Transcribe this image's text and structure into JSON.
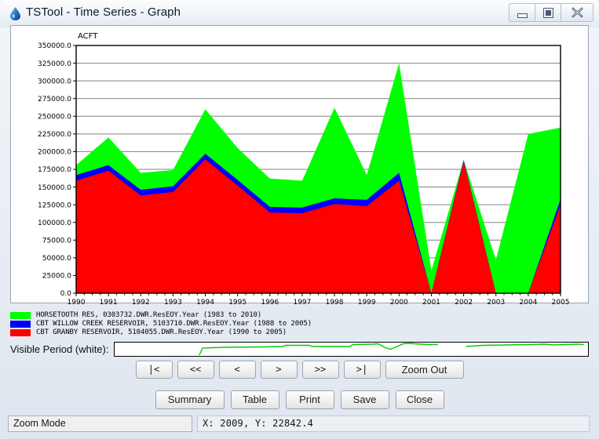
{
  "window": {
    "title": "TSTool - Time Series - Graph",
    "icon": "water-drop-icon",
    "buttons": {
      "minimize": "minimize-icon",
      "maximize": "maximize-icon",
      "close": "close-icon"
    }
  },
  "chart_data": {
    "type": "area",
    "title": "",
    "subtitle": "",
    "xlabel": "",
    "ylabel": "ACFT",
    "yunit": "ACFT",
    "xlim": [
      1990,
      2005
    ],
    "ylim": [
      0,
      350000
    ],
    "grid": true,
    "legend_position": "below",
    "ytick_labels": [
      "0.0",
      "25000.0",
      "50000.0",
      "75000.0",
      "100000.0",
      "125000.0",
      "150000.0",
      "175000.0",
      "200000.0",
      "225000.0",
      "250000.0",
      "275000.0",
      "300000.0",
      "325000.0",
      "350000.0"
    ],
    "ytick_values": [
      0,
      25000,
      50000,
      75000,
      100000,
      125000,
      150000,
      175000,
      200000,
      225000,
      250000,
      275000,
      300000,
      325000,
      350000
    ],
    "xtick_labels": [
      "1990",
      "1991",
      "1992",
      "1993",
      "1994",
      "1995",
      "1996",
      "1997",
      "1998",
      "1999",
      "2000",
      "2001",
      "2002",
      "2003",
      "2004",
      "2005"
    ],
    "x": [
      1990,
      1991,
      1992,
      1993,
      1994,
      1995,
      1996,
      1997,
      1998,
      1999,
      2000,
      2001,
      2002,
      2003,
      2004,
      2005
    ],
    "stacked": true,
    "series": [
      {
        "name": "CBT GRANBY RESERVOIR, 5104055.DWR.ResEOY.Year (1990 to 2005)",
        "color": "#FF0000",
        "values": [
          159000,
          173000,
          138000,
          143000,
          189000,
          152000,
          114000,
          113000,
          126000,
          123000,
          159000,
          0,
          186000,
          0,
          0,
          125000
        ]
      },
      {
        "name": "CBT WILLOW CREEK RESERVOIR, 5103710.DWR.ResEOY.Year (1988 to 2005)",
        "color": "#0000FF",
        "values": [
          8000,
          8000,
          8000,
          8000,
          8000,
          8000,
          8000,
          8000,
          8000,
          9000,
          11000,
          0,
          2000,
          0,
          0,
          8000
        ]
      },
      {
        "name": "HORSETOOTH RES, 0303732.DWR.ResEOY.Year (1983 to 2010)",
        "color": "#00FF00",
        "values": [
          14000,
          39000,
          24000,
          23000,
          63000,
          45000,
          40000,
          38000,
          128000,
          35000,
          155000,
          32000,
          0,
          47000,
          225000,
          101000
        ]
      }
    ],
    "totals": [
      181000,
      220000,
      170000,
      174000,
      260000,
      205000,
      162000,
      159000,
      262000,
      167000,
      325000,
      32000,
      188000,
      47000,
      225000,
      234000
    ],
    "legend": [
      {
        "label": "HORSETOOTH RES, 0303732.DWR.ResEOY.Year (1983 to 2010)",
        "color": "#00FF00"
      },
      {
        "label": "CBT WILLOW CREEK RESERVOIR, 5103710.DWR.ResEOY.Year (1988 to 2005)",
        "color": "#0000FF"
      },
      {
        "label": "CBT GRANBY RESERVOIR, 5104055.DWR.ResEOY.Year (1990 to 2005)",
        "color": "#FF0000"
      }
    ],
    "reference_graph": {
      "color": "#00CC00",
      "description": "visible-period-reference-trace"
    }
  },
  "visible_period": {
    "label": "Visible Period (white):"
  },
  "nav_buttons": [
    {
      "name": "first",
      "label": "|<"
    },
    {
      "name": "page-back",
      "label": "<<"
    },
    {
      "name": "step-back",
      "label": "<"
    },
    {
      "name": "step-forward",
      "label": ">"
    },
    {
      "name": "page-forward",
      "label": ">>"
    },
    {
      "name": "last",
      "label": ">|"
    },
    {
      "name": "zoom-out",
      "label": "Zoom Out"
    }
  ],
  "action_buttons": [
    {
      "name": "summary",
      "label": "Summary"
    },
    {
      "name": "table",
      "label": "Table"
    },
    {
      "name": "print",
      "label": "Print"
    },
    {
      "name": "save",
      "label": "Save"
    },
    {
      "name": "close",
      "label": "Close"
    }
  ],
  "status": {
    "mode": "Zoom Mode",
    "coords": "X:  2009,  Y:  22842.4"
  }
}
